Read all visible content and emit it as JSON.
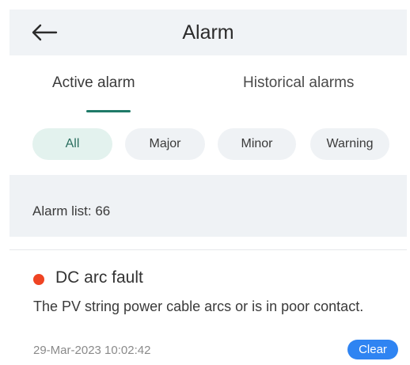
{
  "header": {
    "title": "Alarm",
    "back_icon": "arrow-left-icon"
  },
  "tabs": [
    {
      "label": "Active alarm",
      "selected": true
    },
    {
      "label": "Historical alarms",
      "selected": false
    }
  ],
  "filters": [
    {
      "label": "All",
      "selected": true
    },
    {
      "label": "Major",
      "selected": false
    },
    {
      "label": "Minor",
      "selected": false
    },
    {
      "label": "Warning",
      "selected": false
    }
  ],
  "list": {
    "count_label": "Alarm list: 66",
    "items": [
      {
        "name": "DC arc fault",
        "severity_color": "#ef4423",
        "description": "The PV string power cable arcs or is in poor contact.",
        "timestamp": "29-Mar-2023 10:02:42",
        "status": "Clear"
      }
    ]
  },
  "colors": {
    "accent": "#1f7a68",
    "badge": "#2f84f2",
    "selected_chip_bg": "#e3f2ee"
  }
}
